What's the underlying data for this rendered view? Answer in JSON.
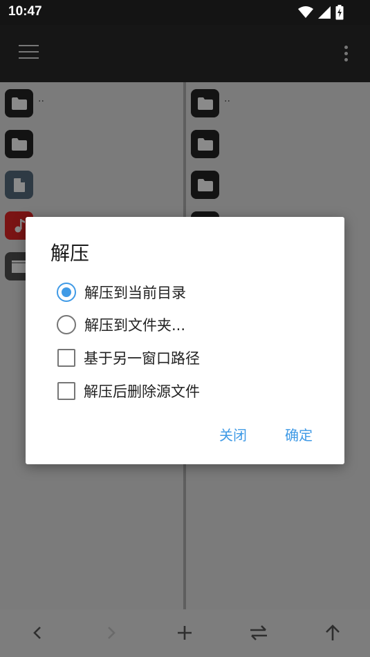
{
  "status_bar": {
    "time": "10:47"
  },
  "app_bar": {
    "menu_icon": "hamburger-icon",
    "overflow_icon": "more-vert-icon"
  },
  "left_pane": {
    "items": [
      {
        "icon": "folder-icon",
        "name": ".."
      },
      {
        "icon": "folder-icon",
        "name": ""
      },
      {
        "icon": "document-icon",
        "name": ""
      },
      {
        "icon": "music-icon",
        "name": ""
      },
      {
        "icon": "video-icon",
        "name": ""
      }
    ]
  },
  "right_pane": {
    "items": [
      {
        "icon": "folder-icon",
        "name": ".."
      },
      {
        "icon": "folder-icon",
        "name": ""
      },
      {
        "icon": "folder-icon",
        "name": ""
      },
      {
        "icon": "folder-icon",
        "name": ""
      }
    ]
  },
  "dialog": {
    "title": "解压",
    "options": [
      {
        "type": "radio",
        "label": "解压到当前目录",
        "checked": true
      },
      {
        "type": "radio",
        "label": "解压到文件夹...",
        "checked": false
      },
      {
        "type": "checkbox",
        "label": "基于另一窗口路径",
        "checked": false
      },
      {
        "type": "checkbox",
        "label": "解压后删除源文件",
        "checked": false
      }
    ],
    "close_label": "关闭",
    "ok_label": "确定"
  },
  "colors": {
    "accent": "#3f9ae6",
    "app_bar": "#161616",
    "scrim": "#7b7b7b"
  }
}
